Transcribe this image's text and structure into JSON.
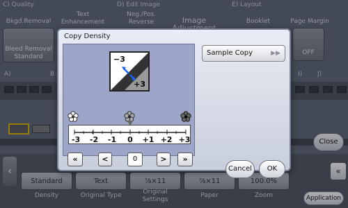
{
  "background": {
    "sections": [
      {
        "label": "C)  Quality"
      },
      {
        "label": "D)  Edit Image"
      },
      {
        "label": "E)  Layout"
      }
    ],
    "tabs": [
      {
        "label": "Bkgd.Removal"
      },
      {
        "label": "Text Enhancement"
      },
      {
        "label": "Neg./Pos. Reverse"
      },
      {
        "label": "Image Adjustment"
      },
      {
        "label": "Booklet"
      },
      {
        "label": "Page Margin"
      }
    ],
    "bleed_button": "Bleed Removal Standard",
    "off_button": "OFF",
    "row_labels": [
      "A)",
      "B",
      "I)",
      "J)"
    ],
    "close_button": "Close",
    "bottom_buttons": [
      {
        "label": "Standard",
        "caption": "Density"
      },
      {
        "label": "Text",
        "caption": "Original Type"
      },
      {
        "label": "⅞×11",
        "caption": "Original Settings"
      },
      {
        "label": "⅞×11",
        "caption": "Paper"
      },
      {
        "label": "100.0%",
        "caption": "Zoom"
      }
    ],
    "application_button": "Application"
  },
  "dialog": {
    "title": "Copy Density",
    "icon_minus": "−3",
    "icon_plus": "+3",
    "scale": [
      "-3",
      "-2",
      "-1",
      "0",
      "+1",
      "+2",
      "+3"
    ],
    "current_value": "0",
    "nav": {
      "far_left": "«",
      "left": "<",
      "right": ">",
      "far_right": "»"
    },
    "sample_copy": "Sample Copy",
    "cancel": "Cancel",
    "ok": "OK"
  }
}
